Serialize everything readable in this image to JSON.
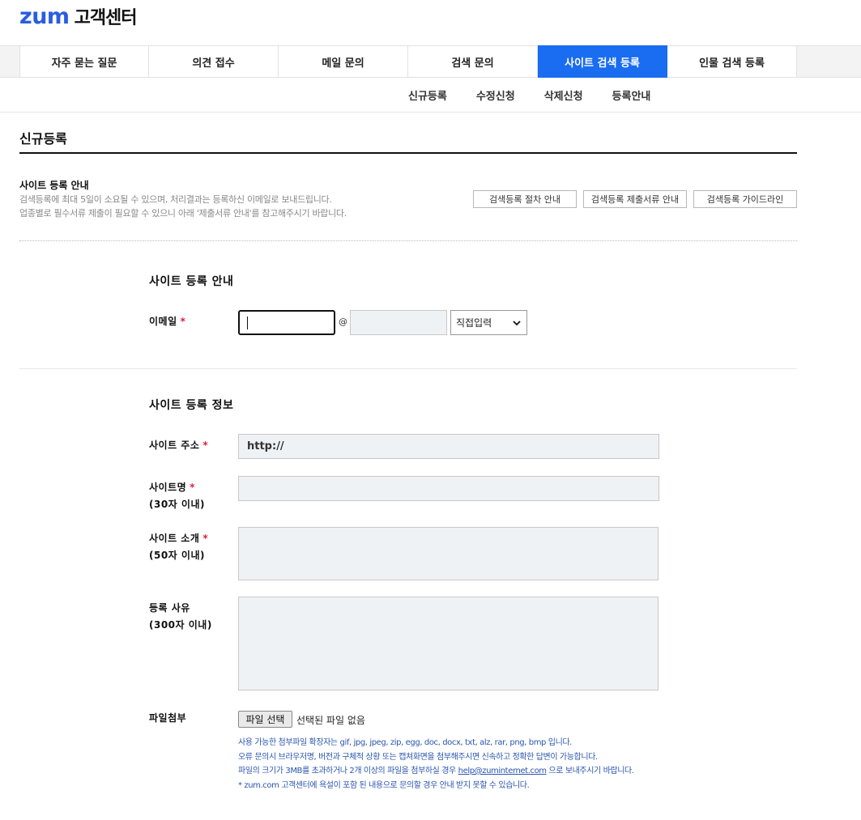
{
  "header": {
    "logo": "zum",
    "title": "고객센터"
  },
  "gnb": {
    "tabs": [
      {
        "label": "자주 묻는 질문",
        "active": false
      },
      {
        "label": "의견 접수",
        "active": false
      },
      {
        "label": "메일 문의",
        "active": false
      },
      {
        "label": "검색 문의",
        "active": false
      },
      {
        "label": "사이트 검색 등록",
        "active": true
      },
      {
        "label": "인물 검색 등록",
        "active": false
      }
    ]
  },
  "lnb": {
    "items": [
      "신규등록",
      "수정신청",
      "삭제신청",
      "등록안내"
    ]
  },
  "page": {
    "title": "신규등록"
  },
  "guide": {
    "title": "사이트 등록 안내",
    "line1": "검색등록에 최대 5일이 소요될 수 있으며, 처리결과는 등록하신 이메일로 보내드립니다.",
    "line2": "업종별로 필수서류 제출이 필요할 수 있으니 아래 '제출서류 안내'를 참고해주시기 바랍니다.",
    "buttons": [
      "검색등록 절차 안내",
      "검색등록 제출서류 안내",
      "검색등록 가이드라인"
    ]
  },
  "section1": {
    "title": "사이트 등록 안내",
    "email_label": "이메일",
    "at": "@",
    "domain_select": "직접입력"
  },
  "section2": {
    "title": "사이트 등록 정보",
    "url_label": "사이트 주소",
    "url_value": "http://",
    "name_label": "사이트명",
    "name_hint": "(30자 이내)",
    "intro_label": "사이트 소개",
    "intro_hint": "(50자 이내)",
    "reason_label": "등록 사유",
    "reason_hint": "(300자 이내)",
    "file_label": "파일첨부",
    "file_button": "파일 선택",
    "file_status": "선택된 파일 없음",
    "notes": {
      "line1": "사용 가능한 첨부파일 확장자는 gif, jpg, jpeg, zip, egg, doc, docx, txt, alz, rar, png, bmp 입니다.",
      "line2": "오류 문의시 브라우저명, 버전과 구체적 상황 또는 캡쳐화면을 첨부해주시면 신속하고 정확한 답변이 가능합니다.",
      "line3_pre": "파일의 크기가 3MB를 초과하거나 2개 이상의 파일을 첨부하실 경우 ",
      "line3_link": "help@zuminternet.com",
      "line3_post": " 으로 보내주시기 바랍니다.",
      "line4": " * zum.com 고객센터에 욕설이 포함 된 내용으로 문의할 경우 안내 받지 못할 수 있습니다."
    }
  },
  "required_mark": "*",
  "colors": {
    "brand": "#2a5de0",
    "active_tab": "#1a6cf0",
    "required": "#e0203a",
    "note": "#2a55b0"
  }
}
